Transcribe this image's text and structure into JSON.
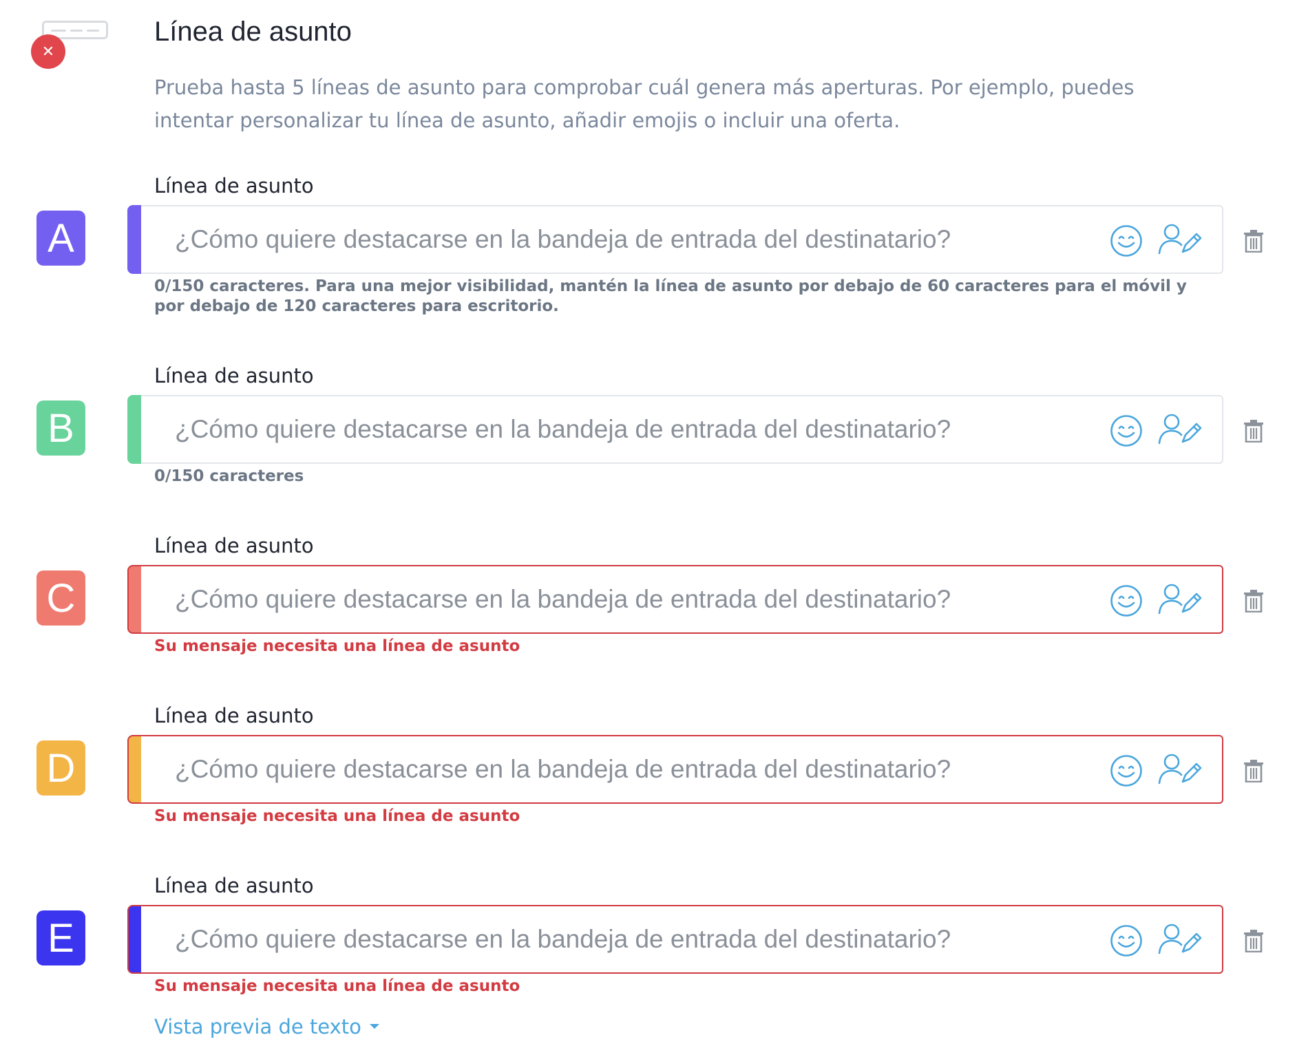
{
  "header": {
    "title": "Línea de asunto",
    "description": "Prueba hasta 5 líneas de asunto para comprobar cuál genera más aperturas. Por ejemplo, puedes intentar personalizar tu línea de asunto, añadir emojis o incluir una oferta."
  },
  "subject_lines": [
    {
      "variant": "A",
      "color": "#7360f0",
      "label": "Línea de asunto",
      "value": "",
      "placeholder": "¿Cómo quiere destacarse en la bandeja de entrada del destinatario?",
      "status": "normal",
      "helper": "0/150 caracteres. Para una mejor visibilidad, mantén la línea de asunto por debajo de 60 caracteres para el móvil y por debajo de 120 caracteres para escritorio."
    },
    {
      "variant": "B",
      "color": "#68d39a",
      "label": "Línea de asunto",
      "value": "",
      "placeholder": "¿Cómo quiere destacarse en la bandeja de entrada del destinatario?",
      "status": "normal",
      "helper": "0/150 caracteres"
    },
    {
      "variant": "C",
      "color": "#ef7a70",
      "label": "Línea de asunto",
      "value": "",
      "placeholder": "¿Cómo quiere destacarse en la bandeja de entrada del destinatario?",
      "status": "error",
      "helper": "Su mensaje necesita una línea de asunto"
    },
    {
      "variant": "D",
      "color": "#f3b546",
      "label": "Línea de asunto",
      "value": "",
      "placeholder": "¿Cómo quiere destacarse en la bandeja de entrada del destinatario?",
      "status": "error",
      "helper": "Su mensaje necesita una línea de asunto"
    },
    {
      "variant": "E",
      "color": "#3c35f0",
      "label": "Línea de asunto",
      "value": "",
      "placeholder": "¿Cómo quiere destacarse en la bandeja de entrada del destinatario?",
      "status": "error",
      "helper": "Su mensaje necesita una línea de asunto"
    }
  ],
  "icons": {
    "header": "subject-line-icon",
    "error": "close-icon",
    "emoji": "emoji-smile-icon",
    "personalize": "personalize-user-edit-icon",
    "delete": "trash-icon",
    "dropdown": "caret-down-icon"
  },
  "colors": {
    "link": "#4aa6dd",
    "error": "#d23b41",
    "icon": "#4aa6dd",
    "muted_text": "#7a879c"
  },
  "footer": {
    "preview_link": "Vista previa de texto"
  }
}
